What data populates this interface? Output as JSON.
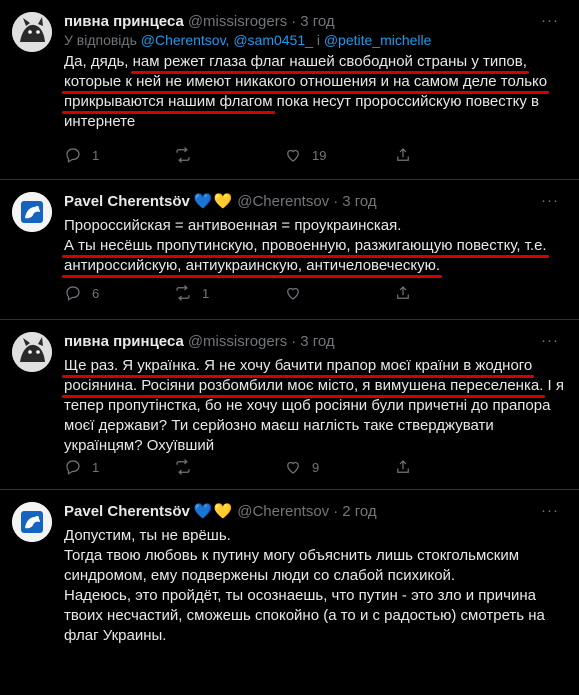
{
  "tweets": [
    {
      "name": "пивна принцеса",
      "handle": "@missisrogers",
      "sep": "·",
      "time": "3 год",
      "reply_prefix": "У відповідь",
      "reply_m1": "@Cherentsov",
      "reply_comma": ",",
      "reply_m2": "@sam0451_",
      "reply_and": "і",
      "reply_m3": "@petite_michelle",
      "t1": "Да, дядь,",
      "t2": "нам режет глаза флаг нашей свободной страны у типов,",
      "t3": "которые к ней не имеют никакого отношения и на самом деле только",
      "t4": "прикрываются нашим флагом",
      "t5": " пока несут пророссийскую повестку в интернете",
      "replies": "1",
      "retweets": "",
      "likes": "19"
    },
    {
      "name": "Pavel Cherentsöv",
      "hearts": "💙💛",
      "handle": "@Cherentsov",
      "sep": "·",
      "time": "3 год",
      "t1": "Пророссийская = антивоенная = проукраинская.",
      "t2": "А ты несёшь пропутинскую, провоенную, разжигающую повестку, т.е.",
      "t3": "антироссийскую, антиукраинскую, античеловеческую.",
      "replies": "6",
      "retweets": "1",
      "likes": ""
    },
    {
      "name": "пивна принцеса",
      "handle": "@missisrogers",
      "sep": "·",
      "time": "3 год",
      "t1": "Ще раз. Я українка. Я не хочу бачити прапор моєї країни в жодного",
      "t2": "росіянина. Росіяни розбомбили моє місто, я вимушена переселенка.",
      "t3": " І я тепер пропутінстка, бо не хочу щоб росіяни були причетні до прапора моєї держави? Ти серйозно маєш наглість таке стверджувати українцям? Охуївший",
      "replies": "1",
      "retweets": "",
      "likes": "9"
    },
    {
      "name": "Pavel Cherentsöv",
      "hearts": "💙💛",
      "handle": "@Cherentsov",
      "sep": "·",
      "time": "2 год",
      "p1": "Допустим, ты не врёшь.",
      "p2": "Тогда твою любовь к путину могу объяснить лишь стокгольмским синдромом, ему подвержены люди со слабой психикой.",
      "p3": "Надеюсь, это пройдёт, ты осознаешь, что путин - это зло и причина твоих несчастий, сможешь спокойно (а то и с радостью) смотреть на флаг Украины."
    }
  ],
  "icons": {
    "reply": "reply-icon",
    "retweet": "retweet-icon",
    "like": "heart-icon",
    "share": "share-icon",
    "more": "more-icon"
  },
  "colors": {
    "background": "#000000",
    "text": "#e7e9ea",
    "muted": "#71767b",
    "link": "#1d9bf0",
    "underline": "#d40000"
  }
}
